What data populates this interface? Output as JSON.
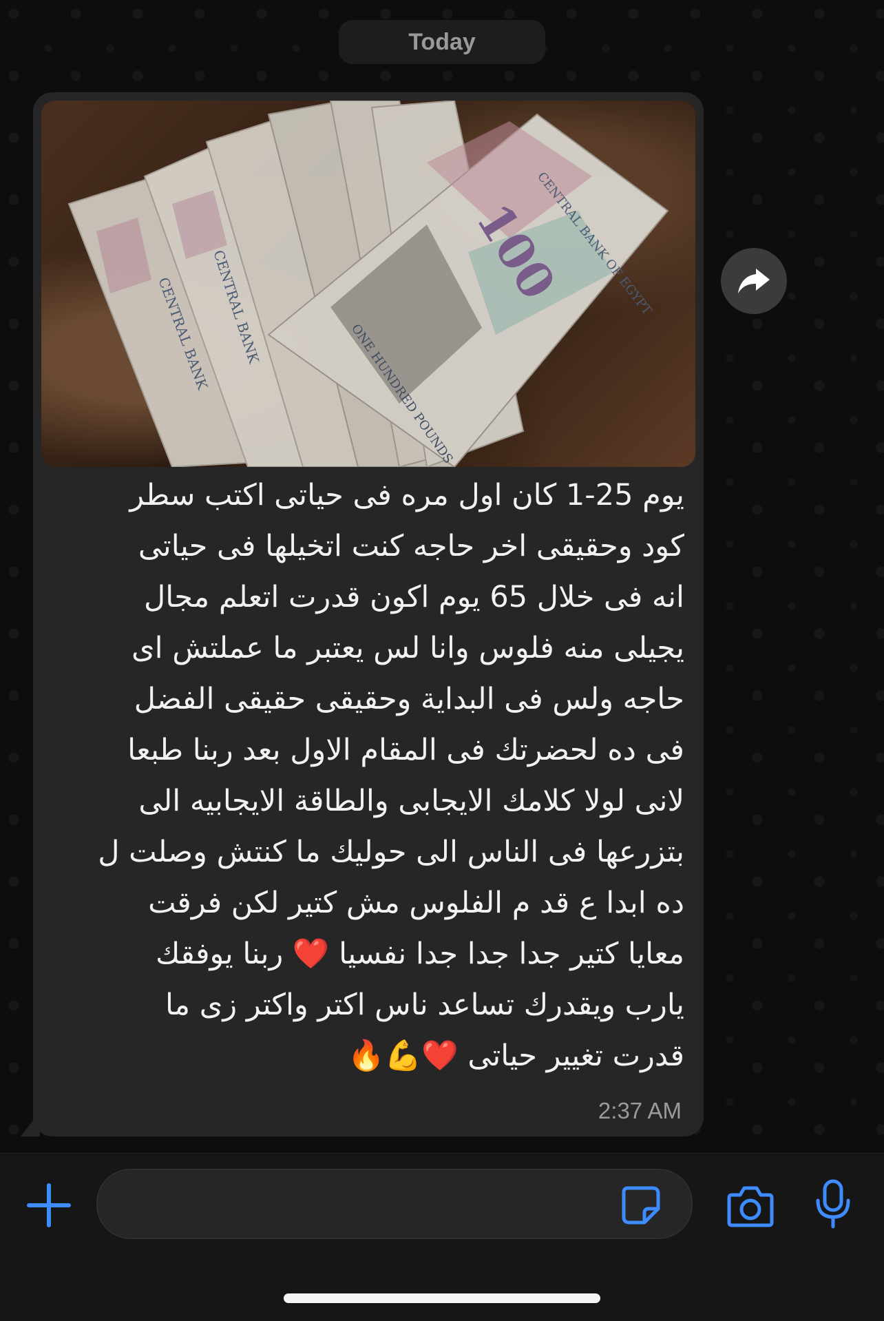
{
  "chat": {
    "date_label": "Today",
    "message": {
      "image": {
        "description_icon": "banknotes-photo",
        "note_labels": [
          "CENTRAL BANK",
          "CENTRAL BANK",
          "CENTRAL BANK OF EGYPT",
          "ONE HUNDRED POUNDS",
          "100"
        ]
      },
      "text": "يوم 25-1 كان اول مره فى حياتى اكتب سطر\nكود وحقيقى اخر حاجه كنت اتخيلها فى حياتى\nانه فى خلال 65 يوم اكون قدرت اتعلم مجال\nيجيلى منه فلوس وانا لس يعتبر ما عملتش اى\nحاجه ولس فى البداية وحقيقى حقيقى الفضل\nفى ده لحضرتك فى المقام الاول بعد ربنا طبعا\nلانى لولا كلامك الايجابى والطاقة الايجابيه الى\nبتزرعها فى الناس الى حوليك ما كنتش وصلت ل\nده ابدا ع قد م الفلوس مش كتير لكن فرقت\nمعايا كتير جدا جدا جدا نفسيا ❤️ ربنا يوفقك\nيارب ويقدرك تساعد ناس اكتر واكتر زى ما\nقدرت تغيير حياتى ❤️💪🔥",
      "time": "2:37 AM"
    },
    "forward_icon": "forward-arrow-icon"
  },
  "composer": {
    "plus_icon": "plus-icon",
    "input_placeholder": "",
    "sticker_icon": "sticker-icon",
    "camera_icon": "camera-icon",
    "mic_icon": "microphone-icon"
  },
  "colors": {
    "background": "#0d0d0d",
    "bubble": "#262626",
    "accent": "#3d8bfd",
    "text": "#f2f2f2",
    "muted": "#9b9b9b"
  }
}
